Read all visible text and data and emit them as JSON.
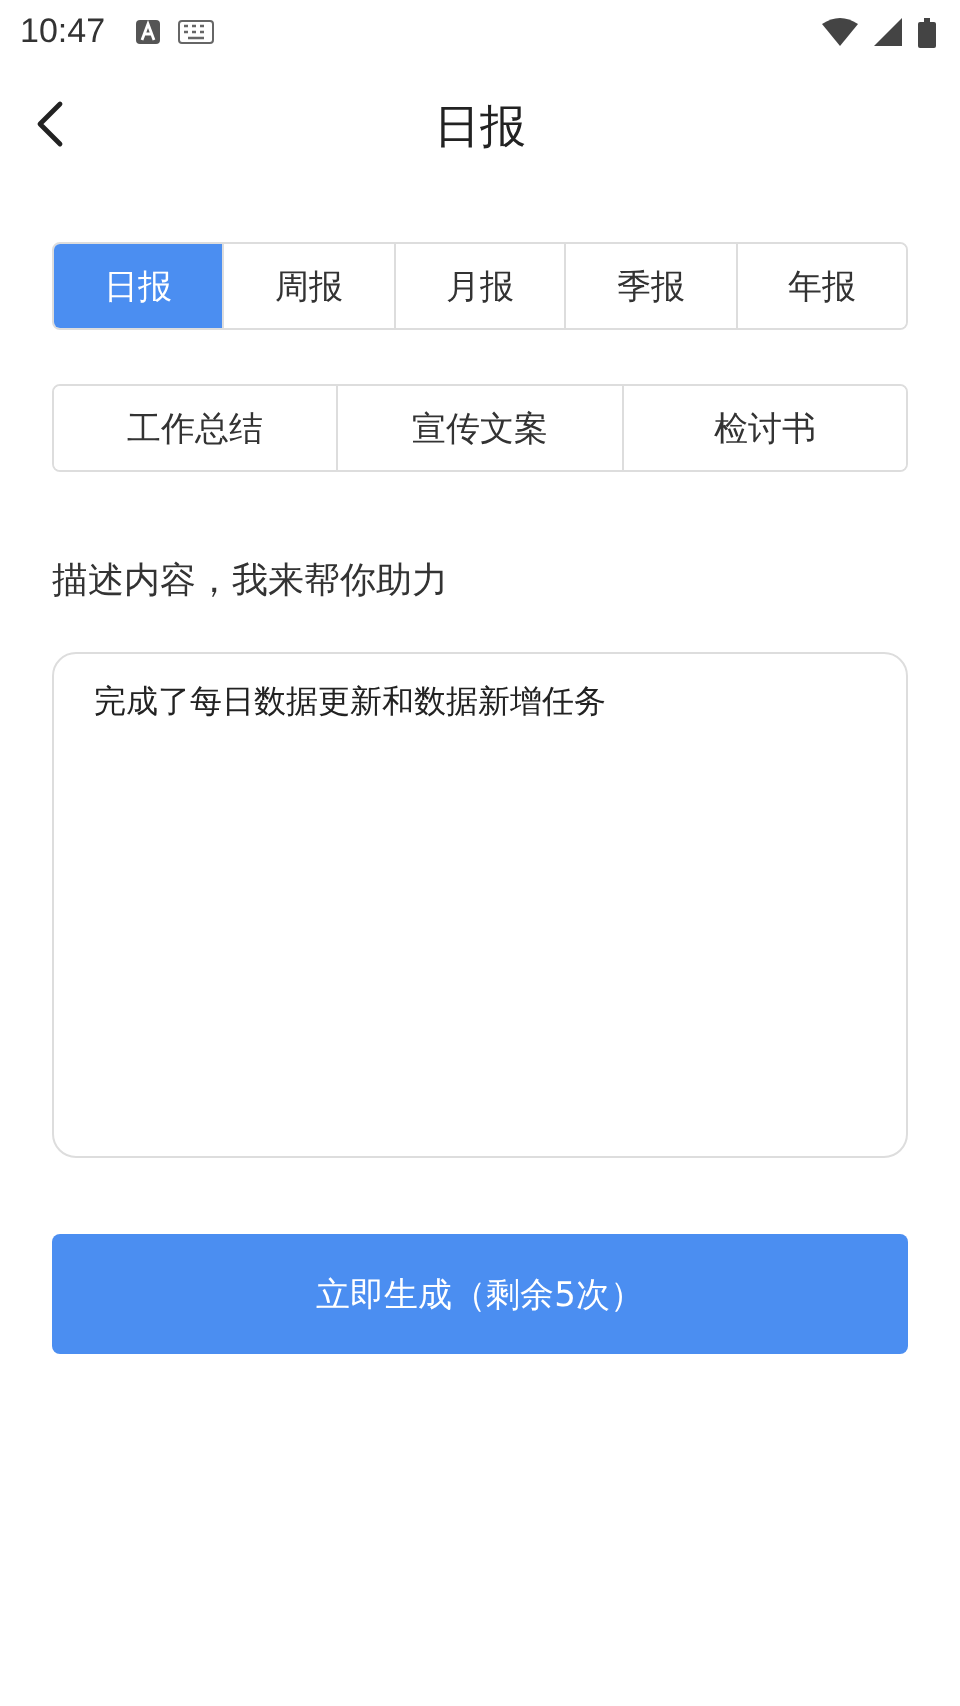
{
  "status_bar": {
    "time": "10:47"
  },
  "header": {
    "title": "日报"
  },
  "report_tabs": [
    {
      "label": "日报",
      "selected": true
    },
    {
      "label": "周报",
      "selected": false
    },
    {
      "label": "月报",
      "selected": false
    },
    {
      "label": "季报",
      "selected": false
    },
    {
      "label": "年报",
      "selected": false
    }
  ],
  "type_tabs": [
    {
      "label": "工作总结",
      "selected": false
    },
    {
      "label": "宣传文案",
      "selected": false
    },
    {
      "label": "检讨书",
      "selected": false
    }
  ],
  "prompt_label": "描述内容，我来帮你助力",
  "description": {
    "value": "完成了每日数据更新和数据新增任务"
  },
  "generate_button": "立即生成（剩余5次）"
}
